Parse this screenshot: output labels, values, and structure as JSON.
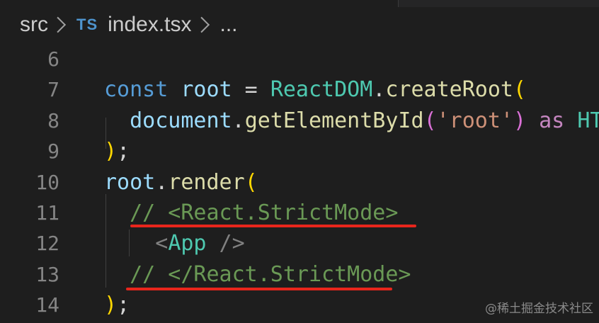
{
  "breadcrumb": {
    "folder": "src",
    "file_icon": "TS",
    "file": "index.tsx",
    "more": "..."
  },
  "colors": {
    "background": "#1e1e1e",
    "keyword": "#569cd6",
    "variable": "#9cdcfe",
    "type": "#4ec9b0",
    "function": "#dcdcaa",
    "string": "#ce9178",
    "comment": "#6a9955",
    "control": "#c586c0",
    "bracket": "#ffd700",
    "annotation": "#e8261c"
  },
  "code_lines": [
    {
      "n": "6",
      "tokens": []
    },
    {
      "n": "7",
      "tokens": [
        {
          "t": "const",
          "c": "#569cd6"
        },
        {
          "t": " ",
          "c": "#d4d4d4"
        },
        {
          "t": "root",
          "c": "#9cdcfe"
        },
        {
          "t": " = ",
          "c": "#d4d4d4"
        },
        {
          "t": "ReactDOM",
          "c": "#4ec9b0"
        },
        {
          "t": ".",
          "c": "#d4d4d4"
        },
        {
          "t": "createRoot",
          "c": "#dcdcaa"
        },
        {
          "t": "(",
          "c": "#ffd700"
        }
      ]
    },
    {
      "n": "8",
      "tokens": [
        {
          "t": "  document",
          "c": "#9cdcfe"
        },
        {
          "t": ".",
          "c": "#d4d4d4"
        },
        {
          "t": "getElementById",
          "c": "#dcdcaa"
        },
        {
          "t": "(",
          "c": "#da70d6"
        },
        {
          "t": "'root'",
          "c": "#ce9178"
        },
        {
          "t": ")",
          "c": "#da70d6"
        },
        {
          "t": " as ",
          "c": "#c586c0"
        },
        {
          "t": "HTML",
          "c": "#4ec9b0"
        }
      ]
    },
    {
      "n": "9",
      "tokens": [
        {
          "t": ")",
          "c": "#ffd700"
        },
        {
          "t": ";",
          "c": "#d4d4d4"
        }
      ]
    },
    {
      "n": "10",
      "tokens": [
        {
          "t": "root",
          "c": "#9cdcfe"
        },
        {
          "t": ".",
          "c": "#d4d4d4"
        },
        {
          "t": "render",
          "c": "#dcdcaa"
        },
        {
          "t": "(",
          "c": "#ffd700"
        }
      ]
    },
    {
      "n": "11",
      "tokens": [
        {
          "t": "  // <React.StrictMode>",
          "c": "#6a9955"
        }
      ]
    },
    {
      "n": "12",
      "tokens": [
        {
          "t": "    <",
          "c": "#808080"
        },
        {
          "t": "App",
          "c": "#4ec9b0"
        },
        {
          "t": " />",
          "c": "#808080"
        }
      ]
    },
    {
      "n": "13",
      "tokens": [
        {
          "t": "  // </React.StrictMode>",
          "c": "#6a9955"
        }
      ]
    },
    {
      "n": "14",
      "tokens": [
        {
          "t": ")",
          "c": "#ffd700"
        },
        {
          "t": ";",
          "c": "#d4d4d4"
        }
      ]
    }
  ],
  "watermark": "@稀土掘金技术社区"
}
